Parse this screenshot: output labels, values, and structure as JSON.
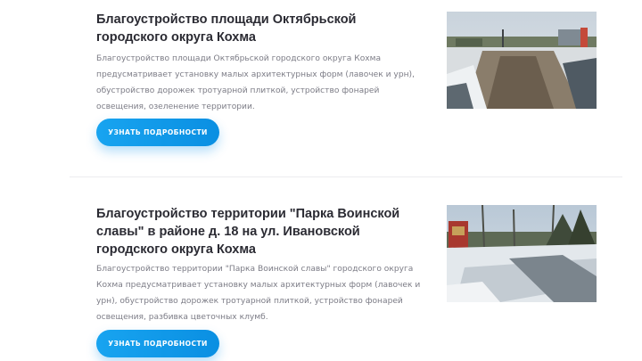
{
  "projects": [
    {
      "title": "Благоустройство площади Октябрьской городского округа Кохма",
      "description": "Благоустройство площади Октябрьской городского округа Кохма предусматривает установку малых архитектурных форм (лавочек и урн), обустройство дорожек тротуарной плиткой, устройство фонарей освещения, озеленение территории.",
      "button_label": "УЗНАТЬ ПОДРОБНОСТИ",
      "photo_icon": "snowy-square-photo"
    },
    {
      "title": "Благоустройство территории \"Парка Воинской славы\" в районе д. 18 на ул. Ивановской городского округа Кохма",
      "description": "Благоустройство территории \"Парка Воинской славы\" городского округа Кохма предусматривает установку малых архитектурных форм (лавочек и урн), обустройство дорожек тротуарной плиткой, устройство фонарей освещения, разбивка цветочных клумб.",
      "button_label": "УЗНАТЬ ПОДРОБНОСТИ",
      "photo_icon": "park-winter-photo"
    }
  ],
  "colors": {
    "accent": "#0a8fe2",
    "title": "#2b2b33",
    "text": "#7c7c86"
  }
}
